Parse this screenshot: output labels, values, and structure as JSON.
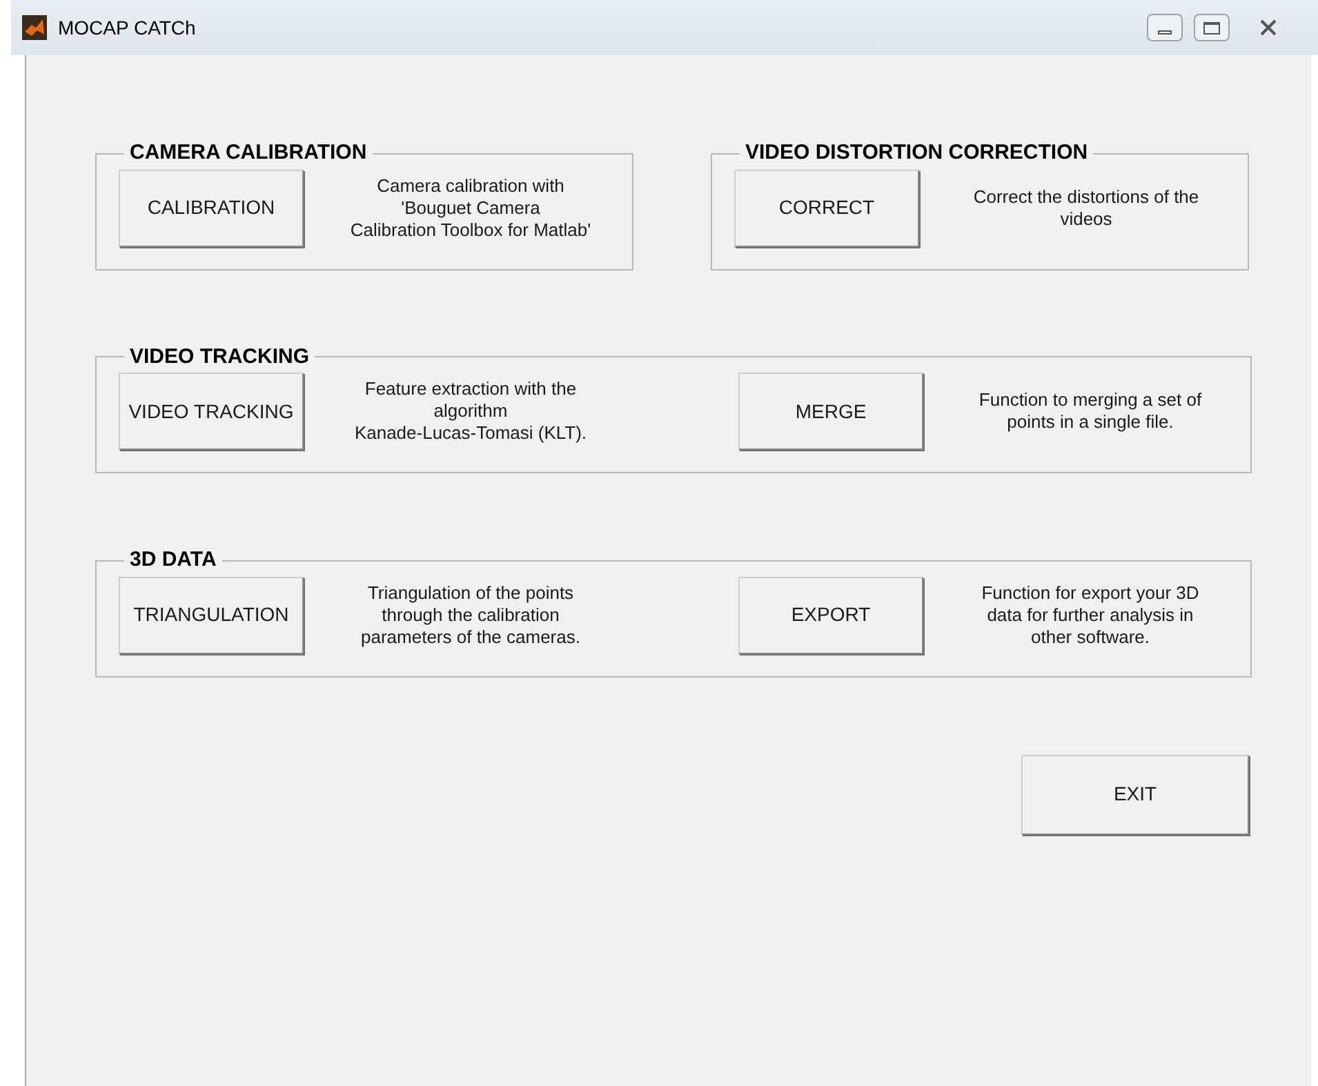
{
  "window": {
    "title": "MOCAP CATCh"
  },
  "sections": [
    {
      "panels": [
        {
          "title": "CAMERA CALIBRATION",
          "items": [
            {
              "button": "CALIBRATION",
              "description": "Camera calibration with\n'Bouguet Camera\nCalibration Toolbox for Matlab'"
            }
          ]
        },
        {
          "title": "VIDEO DISTORTION CORRECTION",
          "items": [
            {
              "button": "CORRECT",
              "description": "Correct the distortions of the\nvideos"
            }
          ]
        }
      ]
    },
    {
      "panels": [
        {
          "title": "VIDEO TRACKING",
          "items": [
            {
              "button": "VIDEO TRACKING",
              "description": "Feature extraction with the\nalgorithm\nKanade-Lucas-Tomasi (KLT)."
            },
            {
              "button": "MERGE",
              "description": "Function to merging a set of\npoints in a single file."
            }
          ]
        }
      ]
    },
    {
      "panels": [
        {
          "title": "3D DATA",
          "items": [
            {
              "button": "TRIANGULATION",
              "description": "Triangulation of the points\nthrough the calibration\nparameters of the cameras."
            },
            {
              "button": "EXPORT",
              "description": "Function for export your 3D\ndata for further analysis in\nother software."
            }
          ]
        }
      ]
    }
  ],
  "exit_button": "EXIT"
}
